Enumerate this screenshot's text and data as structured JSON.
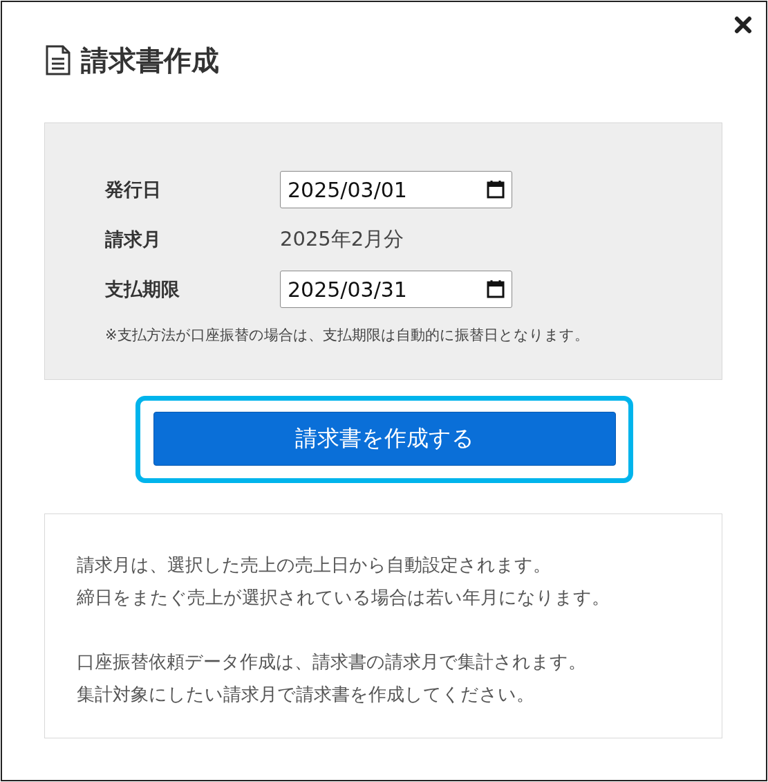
{
  "dialog": {
    "title": "請求書作成"
  },
  "form": {
    "fields": [
      {
        "label": "発行日",
        "kind": "date",
        "value": "2025/03/01"
      },
      {
        "label": "請求月",
        "kind": "text",
        "value": "2025年2月分"
      },
      {
        "label": "支払期限",
        "kind": "date",
        "value": "2025/03/31"
      }
    ],
    "note": "※支払方法が口座振替の場合は、支払期限は自動的に振替日となります。"
  },
  "button": {
    "label": "請求書を作成する",
    "highlighted": true
  },
  "info": {
    "paragraphs": [
      [
        "請求月は、選択した売上の売上日から自動設定されます。",
        "締日をまたぐ売上が選択されている場合は若い年月になります。"
      ],
      [
        "口座振替依頼データ作成は、請求書の請求月で集計されます。",
        "集計対象にしたい請求月で請求書を作成してください。"
      ]
    ]
  }
}
